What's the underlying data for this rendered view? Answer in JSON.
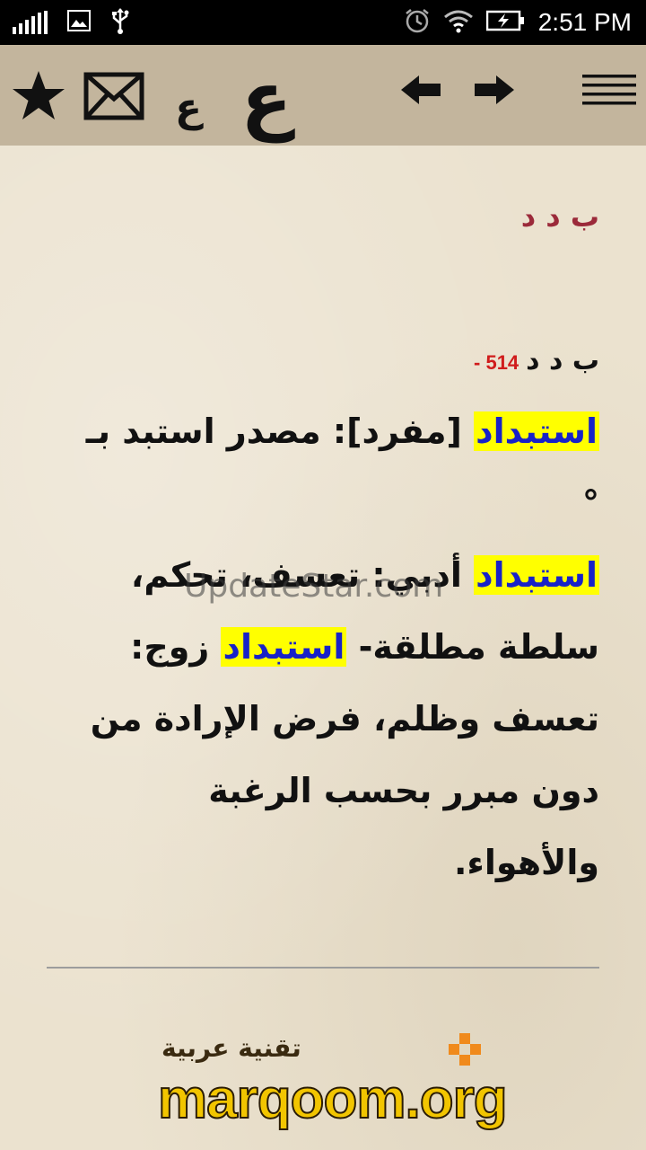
{
  "status_bar": {
    "time": "2:51 PM",
    "icons": [
      "signal-bars-icon",
      "image-icon",
      "usb-icon",
      "alarm-icon",
      "wifi-icon",
      "battery-charging-icon"
    ]
  },
  "toolbar": {
    "buttons": [
      "star-icon",
      "mail-icon",
      "small-ain-icon",
      "large-ain-icon",
      "arrow-left-icon",
      "arrow-right-icon",
      "menu-icon"
    ],
    "small_ain": "ع",
    "large_ain": "ع"
  },
  "entry": {
    "root_header": "ب د د",
    "number": "514 -",
    "root": "ب د د",
    "lines": [
      {
        "hl": "استبداد",
        "text": " [مفرد]: مصدر استبد بـ °"
      },
      {
        "hl": "استبداد",
        "text": " أدبي: تعسف، تحكم،"
      },
      {
        "pre": "سلطة مطلقة- ",
        "hl": "استبداد",
        "text": " زوج:"
      },
      {
        "text": "تعسف وظلم، فرض الإرادة من"
      },
      {
        "text": "دون مبرر بحسب الرغبة والأهواء."
      }
    ]
  },
  "watermark": "UpdateStar.com",
  "brand": {
    "arabic": "تقنية عربية",
    "english": "marqoom.org"
  },
  "colors": {
    "toolbar_bg": "#c3b59d",
    "root_color": "#9b2a3a",
    "number_color": "#d01c1c",
    "highlight_bg": "#ffff00",
    "highlight_text": "#1822c8"
  }
}
